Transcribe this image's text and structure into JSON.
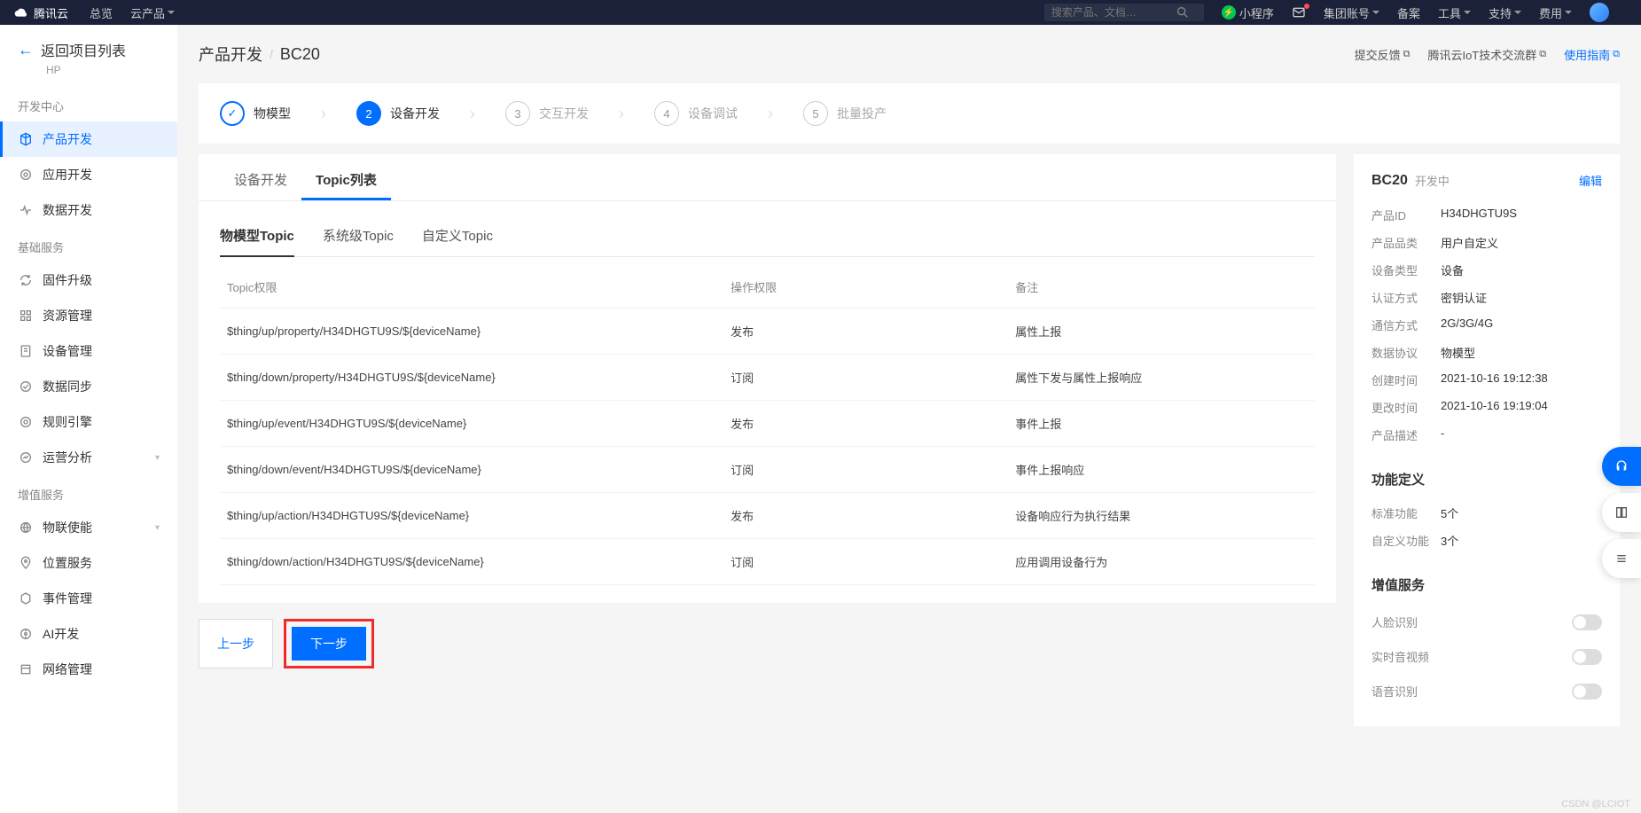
{
  "top_nav": {
    "brand": "腾讯云",
    "items": [
      "总览",
      "云产品"
    ],
    "search_placeholder": "搜索产品、文档…",
    "mini_program": "小程序",
    "account": "集团账号",
    "right_items": [
      "备案",
      "工具",
      "支持",
      "费用"
    ]
  },
  "sidebar": {
    "back_label": "返回项目列表",
    "back_sub": "HP",
    "groups": [
      {
        "title": "开发中心",
        "items": [
          {
            "label": "产品开发",
            "active": true,
            "icon": "cube"
          },
          {
            "label": "应用开发",
            "icon": "layers"
          },
          {
            "label": "数据开发",
            "icon": "flow"
          }
        ]
      },
      {
        "title": "基础服务",
        "items": [
          {
            "label": "固件升级",
            "icon": "refresh"
          },
          {
            "label": "资源管理",
            "icon": "grid"
          },
          {
            "label": "设备管理",
            "icon": "doc"
          },
          {
            "label": "数据同步",
            "icon": "sync"
          },
          {
            "label": "规则引擎",
            "icon": "target"
          },
          {
            "label": "运营分析",
            "icon": "chart",
            "expandable": true
          }
        ]
      },
      {
        "title": "增值服务",
        "items": [
          {
            "label": "物联使能",
            "icon": "globe",
            "expandable": true
          },
          {
            "label": "位置服务",
            "icon": "location"
          },
          {
            "label": "事件管理",
            "icon": "hex"
          },
          {
            "label": "AI开发",
            "icon": "ai"
          },
          {
            "label": "网络管理",
            "icon": "box"
          }
        ]
      }
    ]
  },
  "breadcrumb": {
    "root": "产品开发",
    "current": "BC20"
  },
  "page_actions": [
    {
      "label": "提交反馈",
      "muted": true
    },
    {
      "label": "腾讯云IoT技术交流群",
      "muted": true
    },
    {
      "label": "使用指南",
      "muted": false
    }
  ],
  "steps": [
    {
      "num": "✓",
      "label": "物模型",
      "state": "done"
    },
    {
      "num": "2",
      "label": "设备开发",
      "state": "active"
    },
    {
      "num": "3",
      "label": "交互开发",
      "state": "pending"
    },
    {
      "num": "4",
      "label": "设备调试",
      "state": "pending"
    },
    {
      "num": "5",
      "label": "批量投产",
      "state": "pending"
    }
  ],
  "outer_tabs": [
    {
      "label": "设备开发",
      "active": false
    },
    {
      "label": "Topic列表",
      "active": true
    }
  ],
  "inner_tabs": [
    {
      "label": "物模型Topic",
      "active": true
    },
    {
      "label": "系统级Topic",
      "active": false
    },
    {
      "label": "自定义Topic",
      "active": false
    }
  ],
  "table": {
    "headers": [
      "Topic权限",
      "操作权限",
      "备注"
    ],
    "rows": [
      {
        "topic": "$thing/up/property/H34DHGTU9S/${deviceName}",
        "perm": "发布",
        "note": "属性上报"
      },
      {
        "topic": "$thing/down/property/H34DHGTU9S/${deviceName}",
        "perm": "订阅",
        "note": "属性下发与属性上报响应"
      },
      {
        "topic": "$thing/up/event/H34DHGTU9S/${deviceName}",
        "perm": "发布",
        "note": "事件上报"
      },
      {
        "topic": "$thing/down/event/H34DHGTU9S/${deviceName}",
        "perm": "订阅",
        "note": "事件上报响应"
      },
      {
        "topic": "$thing/up/action/H34DHGTU9S/${deviceName}",
        "perm": "发布",
        "note": "设备响应行为执行结果"
      },
      {
        "topic": "$thing/down/action/H34DHGTU9S/${deviceName}",
        "perm": "订阅",
        "note": "应用调用设备行为"
      }
    ]
  },
  "buttons": {
    "prev": "上一步",
    "next": "下一步"
  },
  "right_panel": {
    "title": "BC20",
    "status": "开发中",
    "edit": "编辑",
    "details": [
      {
        "k": "产品ID",
        "v": "H34DHGTU9S"
      },
      {
        "k": "产品品类",
        "v": "用户自定义"
      },
      {
        "k": "设备类型",
        "v": "设备"
      },
      {
        "k": "认证方式",
        "v": "密钥认证"
      },
      {
        "k": "通信方式",
        "v": "2G/3G/4G"
      },
      {
        "k": "数据协议",
        "v": "物模型"
      },
      {
        "k": "创建时间",
        "v": "2021-10-16 19:12:38"
      },
      {
        "k": "更改时间",
        "v": "2021-10-16 19:19:04"
      },
      {
        "k": "产品描述",
        "v": "-"
      }
    ],
    "func_section": "功能定义",
    "func_kv": [
      {
        "k": "标准功能",
        "v": "5个"
      },
      {
        "k": "自定义功能",
        "v": "3个"
      }
    ],
    "vas_section": "增值服务",
    "toggles": [
      {
        "label": "人脸识别"
      },
      {
        "label": "实时音视频"
      },
      {
        "label": "语音识别"
      }
    ]
  },
  "watermark": "CSDN @LCIOT"
}
